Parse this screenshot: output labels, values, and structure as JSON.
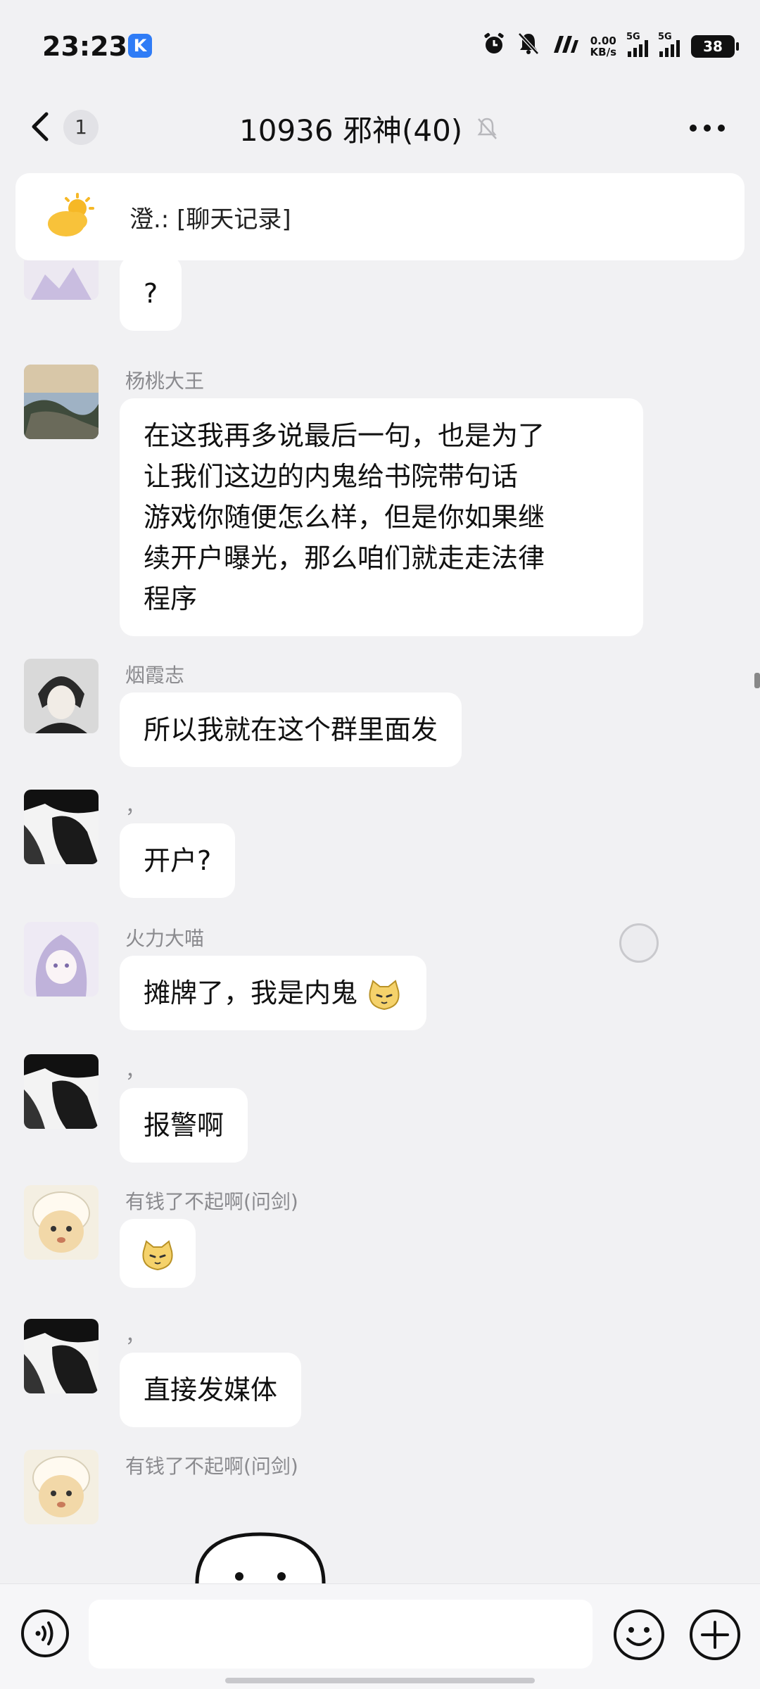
{
  "status_bar": {
    "time": "23:23",
    "app_badge": "K",
    "net_speed_value": "0.00",
    "net_speed_unit": "KB/s",
    "signal1_tag": "5G",
    "signal2_tag": "5G",
    "battery": "38"
  },
  "header": {
    "unread_count": "1",
    "title": "10936  邪神(40)",
    "more_icon": "more-dots-icon"
  },
  "pinned": {
    "text": "澄.: [聊天记录]",
    "icon": "sun-cloud-icon"
  },
  "messages": [
    {
      "sender": "",
      "text": "?"
    },
    {
      "sender": "杨桃大王",
      "lines": [
        "在这我再多说最后一句，也是为了",
        "让我们这边的内鬼给书院带句话",
        "游戏你随便怎么样，但是你如果继",
        "续开户曝光，那么咱们就走走法律",
        "程序"
      ]
    },
    {
      "sender": "烟霞志",
      "text": "所以我就在这个群里面发"
    },
    {
      "sender": "，",
      "text": "开户?"
    },
    {
      "sender": "火力大喵",
      "text": "摊牌了，我是内鬼"
    },
    {
      "sender": "，",
      "text": "报警啊"
    },
    {
      "sender": "有钱了不起啊(问剑)",
      "text": ""
    },
    {
      "sender": "，",
      "text": "直接发媒体"
    },
    {
      "sender": "有钱了不起啊(问剑)",
      "text": ""
    }
  ],
  "input": {
    "placeholder": "",
    "voice_icon": "voice-icon",
    "emoji_icon": "emoji-icon",
    "plus_icon": "plus-icon"
  }
}
